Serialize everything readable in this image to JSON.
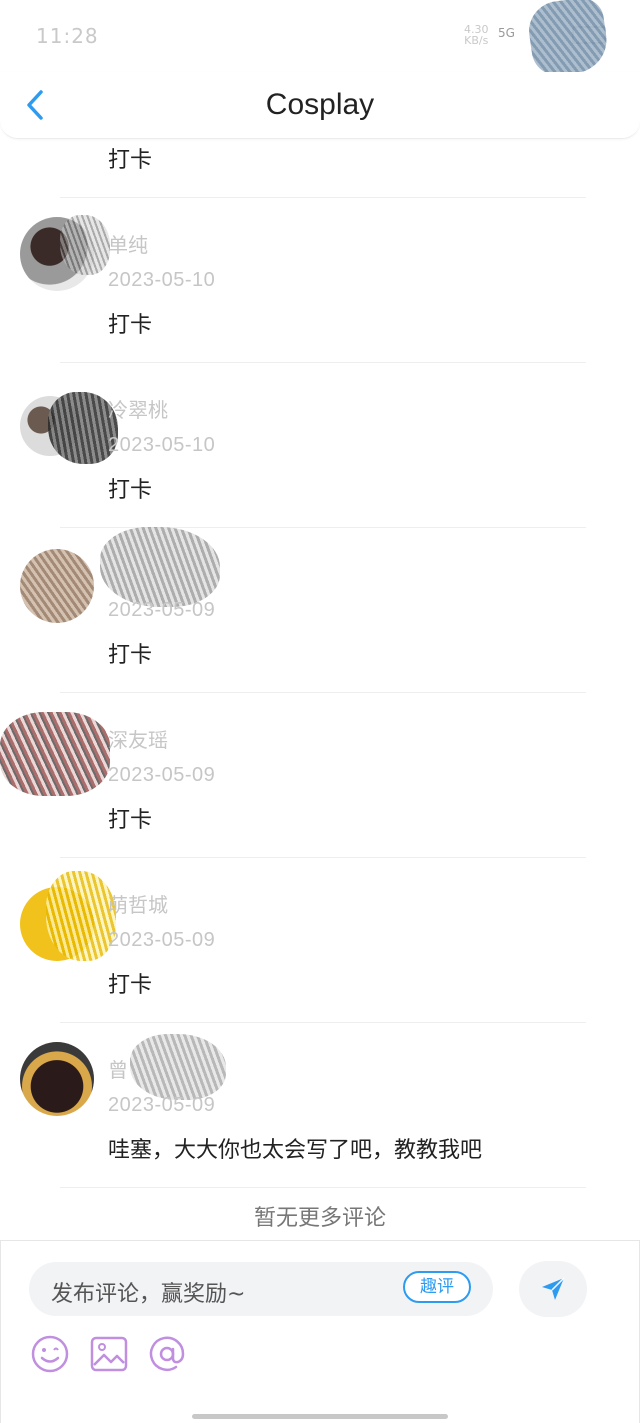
{
  "status_bar": {
    "time": "11:28",
    "net_speed": "4.30",
    "net_unit": "KB/s",
    "signal": "5G"
  },
  "header": {
    "title": "Cosplay"
  },
  "first_comment": {
    "text": "打卡"
  },
  "comments": [
    {
      "name": "单纯",
      "date": "2023-05-10",
      "text": "打卡"
    },
    {
      "name": "冷翠桃",
      "date": "2023-05-10",
      "text": "打卡"
    },
    {
      "name": "",
      "date": "2023-05-09",
      "text": "打卡"
    },
    {
      "name": "深友瑶",
      "date": "2023-05-09",
      "text": "打卡"
    },
    {
      "name": "萌哲城",
      "date": "2023-05-09",
      "text": "打卡"
    },
    {
      "name": "曾",
      "date": "2023-05-09",
      "text": "哇塞，大大你也太会写了吧，教教我吧"
    }
  ],
  "footer": {
    "no_more": "暂无更多评论"
  },
  "composer": {
    "placeholder": "发布评论，赢奖励~",
    "fun_label": "趣评"
  },
  "icons": {
    "back": "chevron-left-icon",
    "send": "paper-plane-icon",
    "emoji": "emoji-icon",
    "image": "image-icon",
    "mention": "at-sign-icon"
  },
  "colors": {
    "accent": "#2d9bf0",
    "tool_icon": "#c08fe0"
  }
}
